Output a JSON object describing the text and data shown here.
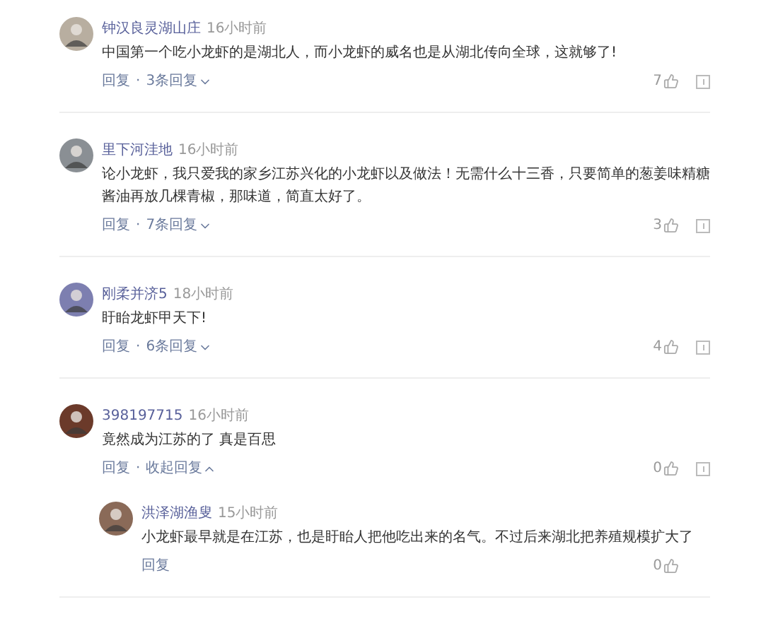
{
  "comments": [
    {
      "user": "钟汉良灵湖山庄",
      "time": "16小时前",
      "text": "中国第一个吃小龙虾的是湖北人，而小龙虾的威名也是从湖北传向全球，这就够了!",
      "reply": "回复",
      "separator": "·",
      "replies_link": "3条回复",
      "expanded": false,
      "likes": "7",
      "report": true
    },
    {
      "user": "里下河洼地",
      "time": "16小时前",
      "text": "论小龙虾，我只爱我的家乡江苏兴化的小龙虾以及做法！无需什么十三香，只要简单的葱姜味精糖酱油再放几棵青椒，那味道，简直太好了。",
      "reply": "回复",
      "separator": "·",
      "replies_link": "7条回复",
      "expanded": false,
      "likes": "3",
      "report": true
    },
    {
      "user": "刚柔并济5",
      "time": "18小时前",
      "text": "盱眙龙虾甲天下!",
      "reply": "回复",
      "separator": "·",
      "replies_link": "6条回复",
      "expanded": false,
      "likes": "4",
      "report": true
    },
    {
      "user": "398197715",
      "time": "16小时前",
      "text": "竟然成为江苏的了 真是百思",
      "reply": "回复",
      "separator": "·",
      "replies_link": "收起回复",
      "expanded": true,
      "likes": "0",
      "report": true,
      "replies": [
        {
          "user": "洪泽湖渔叟",
          "time": "15小时前",
          "text": "小龙虾最早就是在江苏，也是盱眙人把他吃出来的名气。不过后来湖北把养殖规模扩大了",
          "reply": "回复",
          "likes": "0",
          "report": false
        }
      ]
    }
  ]
}
